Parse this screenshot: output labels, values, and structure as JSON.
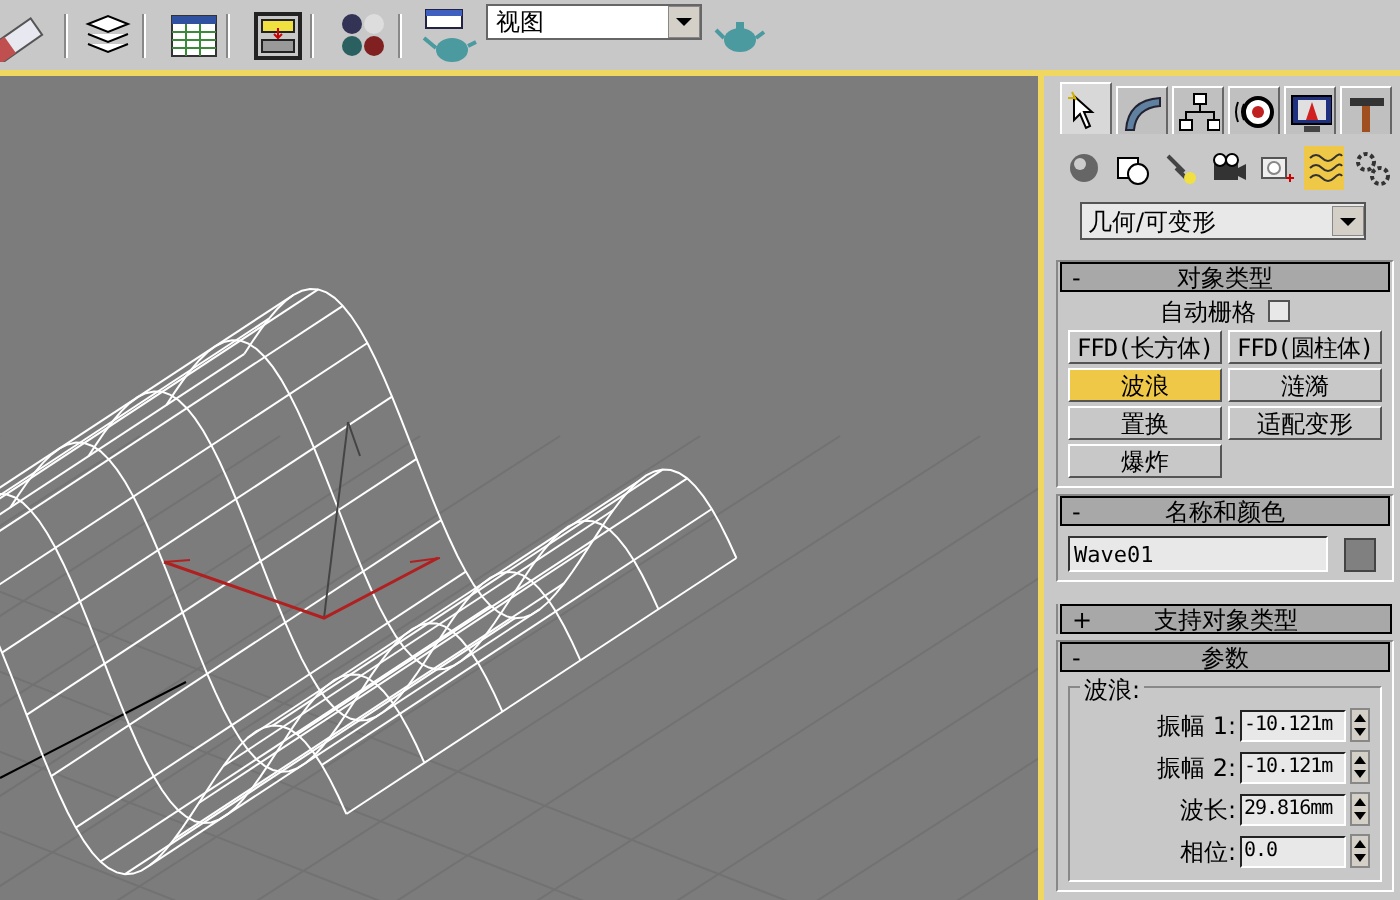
{
  "toolbar": {
    "view_dropdown": "视图"
  },
  "command_panel": {
    "tabs": [
      {
        "selected": true
      },
      {
        "selected": false
      },
      {
        "selected": false
      },
      {
        "selected": false
      },
      {
        "selected": false
      },
      {
        "selected": false
      }
    ],
    "categories": [
      {
        "selected": false
      },
      {
        "selected": false
      },
      {
        "selected": false
      },
      {
        "selected": false
      },
      {
        "selected": false
      },
      {
        "selected": true
      },
      {
        "selected": false
      }
    ],
    "category_dropdown": "几何/可变形",
    "rollouts": [
      {
        "kind": "object_type",
        "toggle": "-",
        "title": "对象类型",
        "autogrid": {
          "label": "自动栅格",
          "checked": false
        },
        "buttons": [
          {
            "label": "FFD(长方体)",
            "selected": false
          },
          {
            "label": "FFD(圆柱体)",
            "selected": false
          },
          {
            "label": "波浪",
            "selected": true
          },
          {
            "label": "涟漪",
            "selected": false
          },
          {
            "label": "置换",
            "selected": false
          },
          {
            "label": "适配变形",
            "selected": false
          },
          {
            "label": "爆炸",
            "selected": false
          }
        ]
      },
      {
        "kind": "name_color",
        "toggle": "-",
        "title": "名称和颜色",
        "name": "Wave01",
        "color": "#808080"
      },
      {
        "kind": "collapsed",
        "toggle": "+",
        "title": "支持对象类型"
      },
      {
        "kind": "parameters",
        "toggle": "-",
        "title": "参数",
        "group": "波浪:",
        "fields": [
          {
            "label": "振幅 1:",
            "value": "-10.121m"
          },
          {
            "label": "振幅 2:",
            "value": "-10.121m"
          },
          {
            "label": "波长:",
            "value": "29.816mm"
          },
          {
            "label": "相位:",
            "value": "0.0"
          }
        ]
      }
    ]
  }
}
